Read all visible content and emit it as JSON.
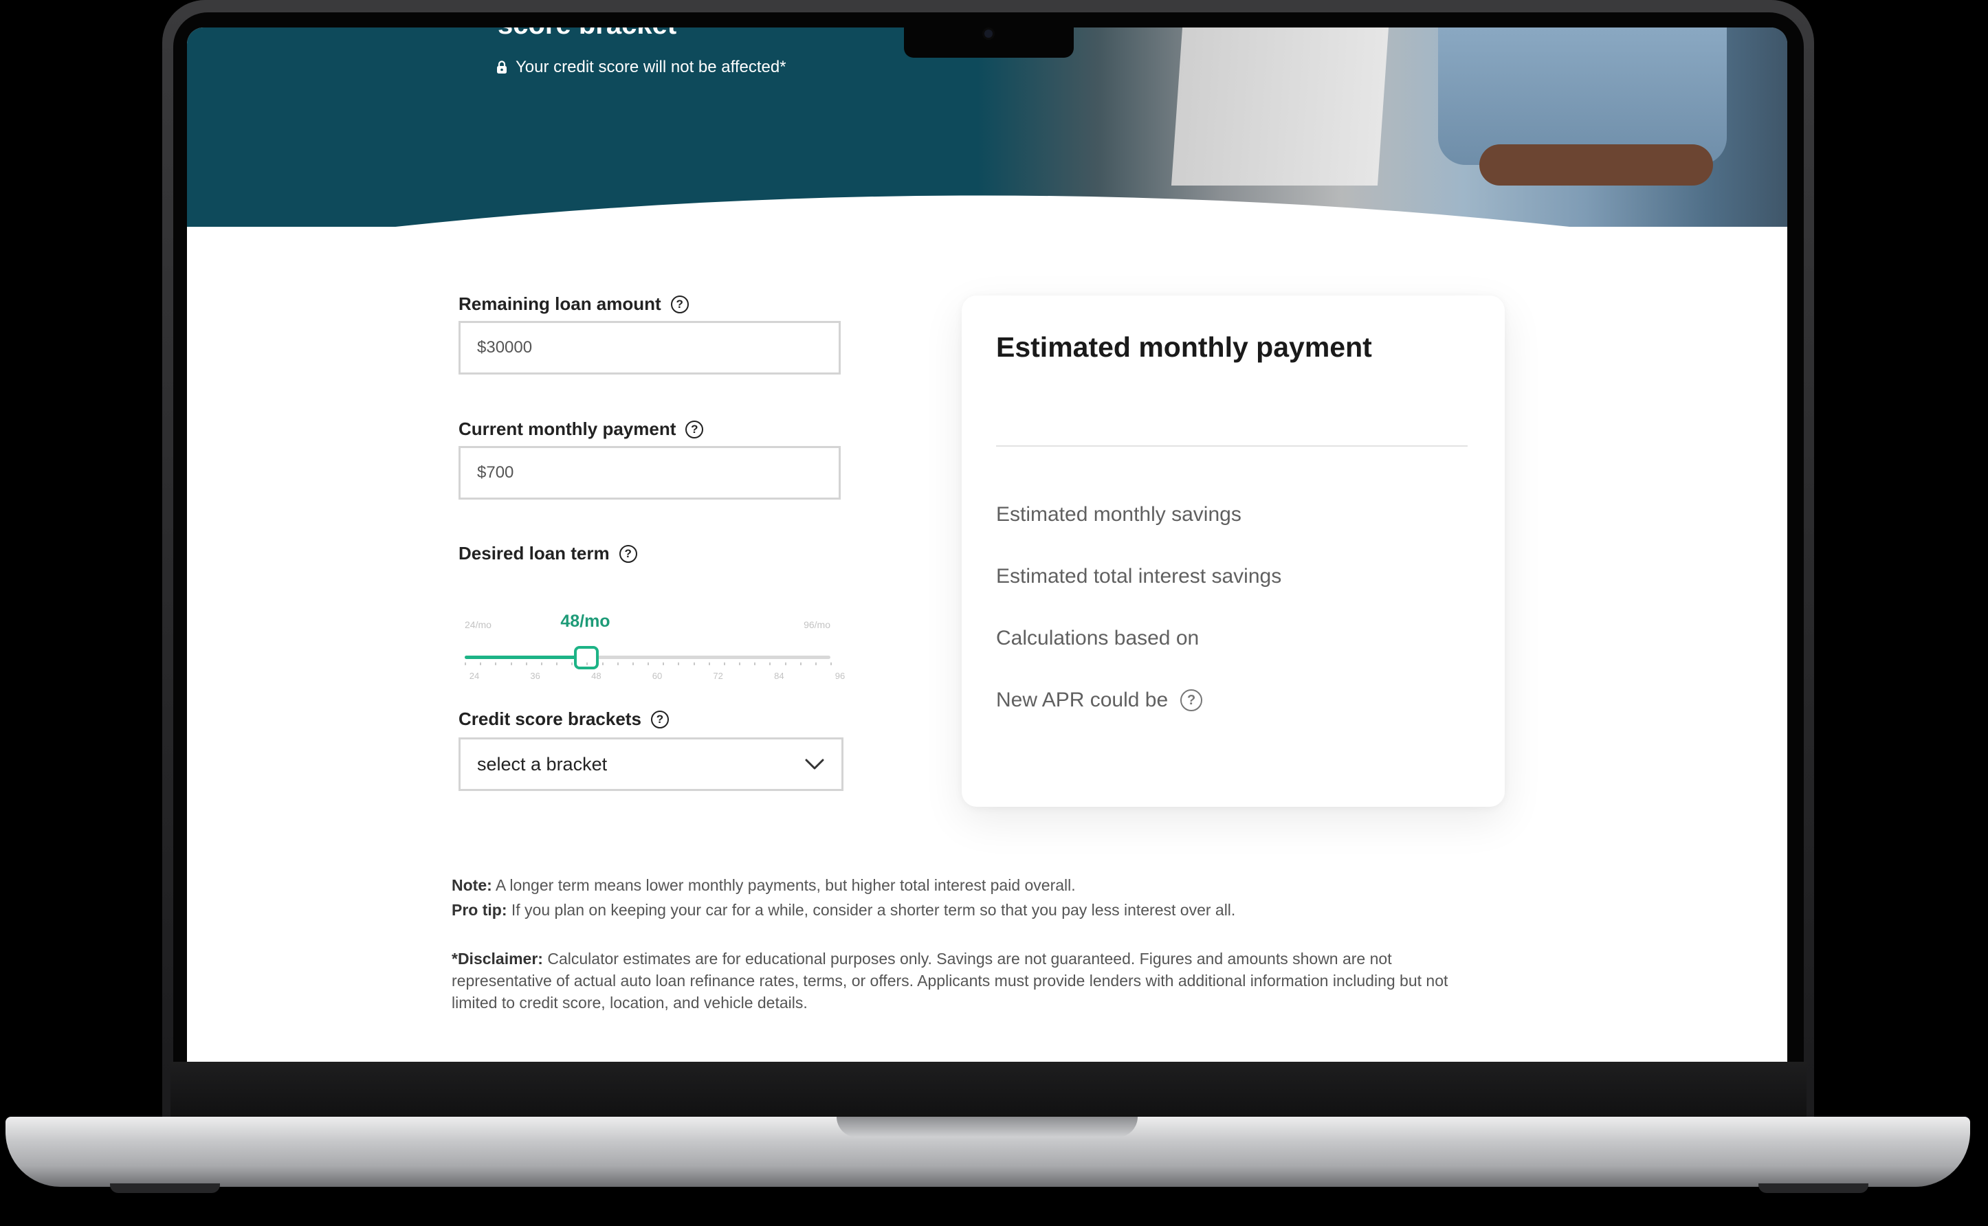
{
  "hero": {
    "headline_fragment": "score bracket",
    "credit_note": "Your credit score will not be affected*"
  },
  "form": {
    "loan_amount": {
      "label": "Remaining loan amount",
      "value": "$30000"
    },
    "monthly_payment": {
      "label": "Current monthly payment",
      "value": "$700"
    },
    "loan_term": {
      "label": "Desired loan term",
      "value_display": "48/mo",
      "value": 48,
      "min": 24,
      "max": 96,
      "min_label": "24/mo",
      "max_label": "96/mo",
      "ticks": [
        "24",
        "36",
        "48",
        "60",
        "72",
        "84",
        "96"
      ]
    },
    "credit_score": {
      "label": "Credit score brackets",
      "selected": "select a bracket"
    }
  },
  "results": {
    "title": "Estimated monthly payment",
    "rows": [
      "Estimated monthly savings",
      "Estimated total interest savings",
      "Calculations based on",
      "New APR could be"
    ]
  },
  "notes": {
    "note_label": "Note:",
    "note_text": " A longer term means lower monthly payments, but higher total interest paid overall.",
    "tip_label": "Pro tip:",
    "tip_text": " If you plan on keeping your car for a while, consider a shorter term so that you pay less interest over all.",
    "disclaimer_label": "*Disclaimer:",
    "disclaimer_text": " Calculator estimates are for educational purposes only. Savings are not guaranteed. Figures and amounts shown are not representative of actual auto loan refinance rates, terms, or offers. Applicants must provide lenders with additional information including but not limited to credit score, location, and vehicle details."
  },
  "colors": {
    "hero_bg": "#0e4a5b",
    "accent_green": "#1db386",
    "value_green": "#1e9b78"
  },
  "icons": {
    "help": "question-circle-icon",
    "lock": "lock-icon",
    "chevron": "chevron-down-icon"
  }
}
